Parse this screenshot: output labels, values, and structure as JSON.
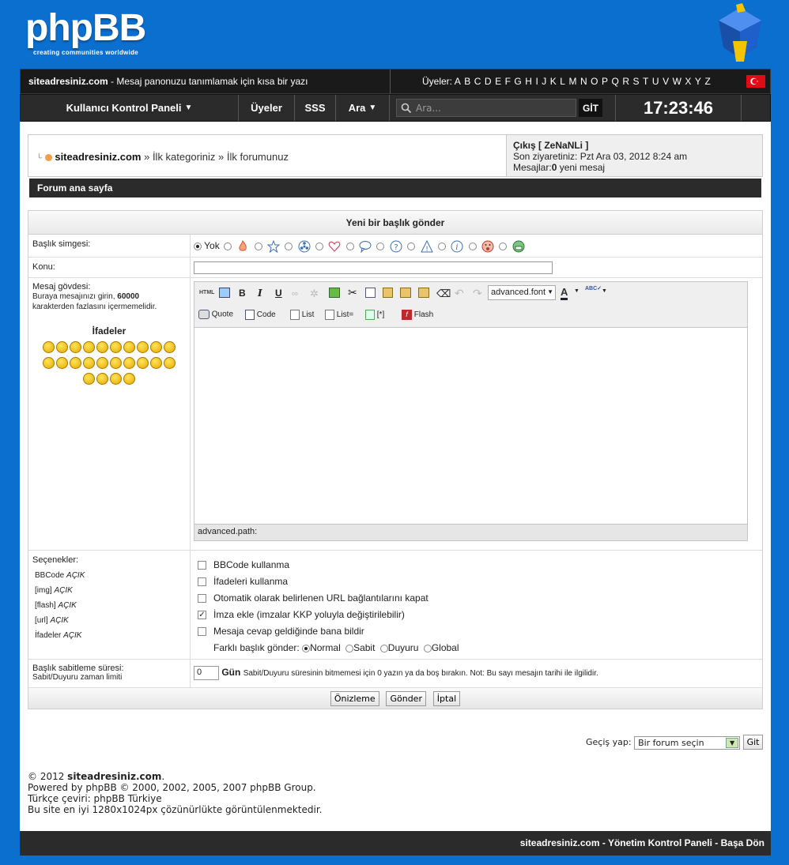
{
  "brand": {
    "logo_text": "phpBB",
    "tagline": "creating communities worldwide"
  },
  "topbar": {
    "site": "siteadresiniz.com",
    "desc": " - Mesaj panonuzu tanımlamak için kısa bir yazı",
    "members_label": "Üyeler:",
    "letters": [
      "A",
      "B",
      "C",
      "D",
      "E",
      "F",
      "G",
      "H",
      "I",
      "J",
      "K",
      "L",
      "M",
      "N",
      "O",
      "P",
      "Q",
      "R",
      "S",
      "T",
      "U",
      "V",
      "W",
      "X",
      "Y",
      "Z"
    ]
  },
  "nav": {
    "ucp": "Kullanıcı Kontrol Paneli",
    "members": "Üyeler",
    "faq": "SSS",
    "search": "Ara",
    "search_placeholder": "Ara...",
    "go": "GİT",
    "time": "17:23:46"
  },
  "breadcrumb": {
    "home": "siteadresiniz.com",
    "sep": "»",
    "cat": "İlk kategoriniz",
    "forum": "İlk forumunuz"
  },
  "user": {
    "logout": "Çıkış [ ZeNaNLi ]",
    "last_visit": "Son ziyaretiniz: Pzt Ara 03, 2012 8:24 am",
    "messages_label": "Mesajlar:",
    "messages_count": "0",
    "messages_suffix": " yeni mesaj"
  },
  "forumbar": "Forum ana sayfa",
  "form": {
    "title": "Yeni bir başlık gönder",
    "icon_label": "Başlık simgesi:",
    "icon_none": "Yok",
    "subject_label": "Konu:",
    "body_label": "Mesaj gövdesi:",
    "body_hint_1": "Buraya mesajınızı girin, ",
    "body_hint_limit": "60000",
    "body_hint_2": "karakterden fazlasını içermemelidir.",
    "smilies_title": "İfadeler",
    "font_select": "advanced.font",
    "tb_quote": "Quote",
    "tb_code": "Code",
    "tb_list": "List",
    "tb_listeq": "List=",
    "tb_star": "[*]",
    "tb_flash": "Flash",
    "path": "advanced.path:",
    "options_label": "Seçenekler:",
    "opt_bbcode": "BBCode",
    "opt_img": "[img]",
    "opt_flash": "[flash]",
    "opt_url": "[url]",
    "opt_smilies": "İfadeler",
    "on": "AÇIK",
    "chk_bbcode": "BBCode kullanma",
    "chk_smilies": "İfadeleri kullanma",
    "chk_urls": "Otomatik olarak belirlenen URL bağlantılarını kapat",
    "chk_sig": "İmza ekle (imzalar KKP yoluyla değiştirilebilir)",
    "chk_notify": "Mesaja cevap geldiğinde bana bildir",
    "type_label": "Farklı başlık gönder:",
    "type_normal": "Normal",
    "type_sticky": "Sabit",
    "type_announce": "Duyuru",
    "type_global": "Global",
    "sticky_label": "Başlık sabitleme süresi:",
    "sticky_hint": "Sabit/Duyuru zaman limiti",
    "sticky_value": "0",
    "sticky_unit": "Gün",
    "sticky_note": "Sabit/Duyuru süresinin bitmemesi için 0 yazın ya da boş bırakın. Not: Bu sayı mesajın tarihi ile ilgilidir.",
    "btn_preview": "Önizleme",
    "btn_submit": "Gönder",
    "btn_cancel": "İptal"
  },
  "jump": {
    "label": "Geçiş yap:",
    "select": "Bir forum seçin",
    "go": "Git"
  },
  "footer": {
    "line1_a": "© 2012 ",
    "line1_b": "siteadresiniz.com",
    "line1_c": ".",
    "line2": "Powered by phpBB © 2000, 2002, 2005, 2007 phpBB Group.",
    "line3": "Türkçe çeviri: phpBB Türkiye",
    "line4": "Bu site en iyi 1280x1024px çözünürlükte görüntülenmektedir.",
    "bottom_site": "siteadresiniz.com",
    "bottom_acp": "Yönetim Kontrol Paneli",
    "bottom_top": "Başa Dön",
    "bottom_sep": " - "
  },
  "colors": {
    "background": "#0a6fcf",
    "bar": "#2b2b2b"
  }
}
